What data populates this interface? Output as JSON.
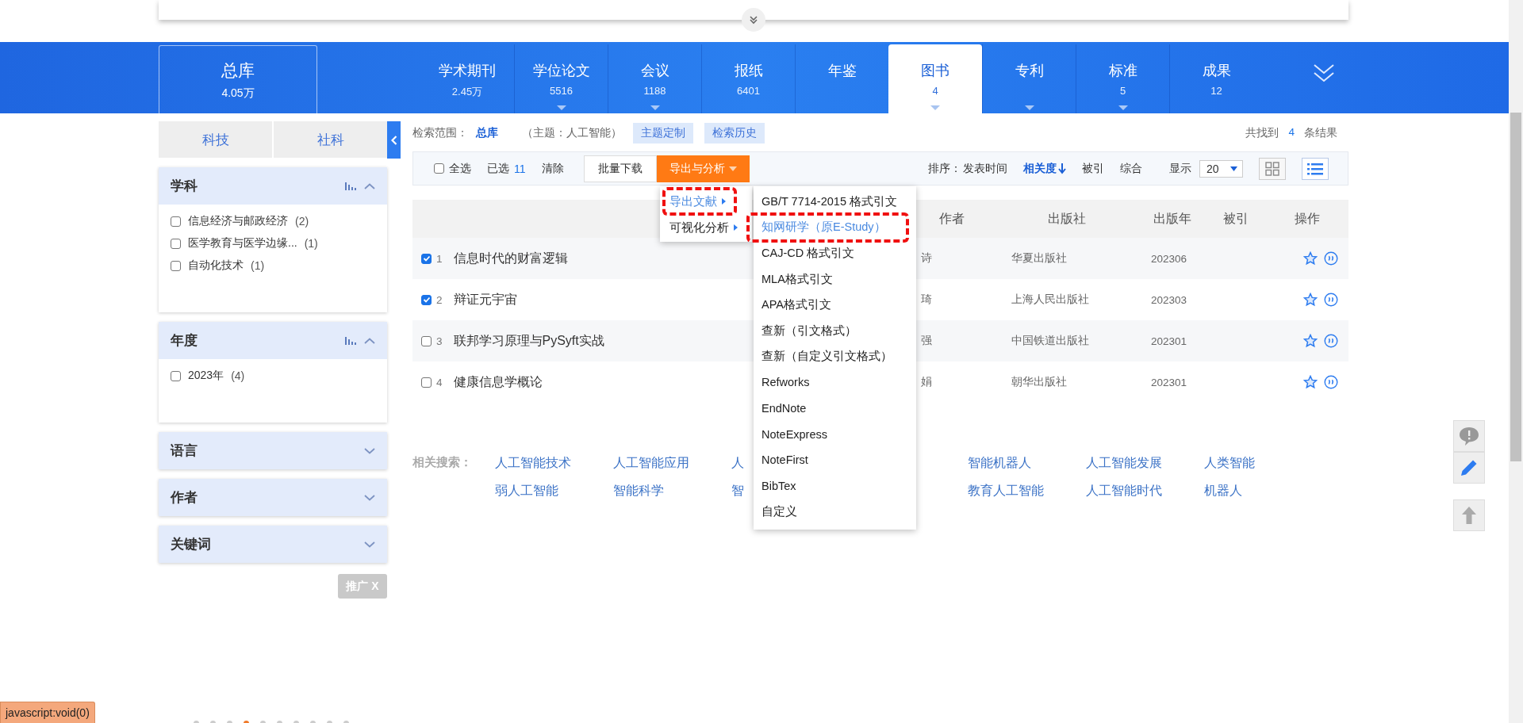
{
  "database_nav": {
    "total": {
      "label": "总库",
      "count": "4.05万"
    },
    "tabs": [
      {
        "label": "学术期刊",
        "count": "2.45万",
        "caret": false,
        "selected": false
      },
      {
        "label": "学位论文",
        "count": "5516",
        "caret": true,
        "selected": false
      },
      {
        "label": "会议",
        "count": "1188",
        "caret": true,
        "selected": false
      },
      {
        "label": "报纸",
        "count": "6401",
        "caret": false,
        "selected": false
      },
      {
        "label": "年鉴",
        "caret": false,
        "selected": false
      },
      {
        "label": "图书",
        "count": "4",
        "caret": true,
        "selected": true
      },
      {
        "label": "专利",
        "caret": true,
        "selected": false
      },
      {
        "label": "标准",
        "count": "5",
        "caret": true,
        "selected": false
      },
      {
        "label": "成果",
        "count": "12",
        "caret": false,
        "selected": false
      }
    ]
  },
  "sidebar": {
    "tabs": [
      {
        "label": "科技",
        "selected": false
      },
      {
        "label": "社科",
        "selected": false
      }
    ],
    "facets": [
      {
        "title": "学科",
        "expanded": true,
        "items": [
          {
            "label": "信息经济与邮政经济",
            "count": "(2)",
            "checked": false
          },
          {
            "label": "医学教育与医学边缘...",
            "count": "(1)",
            "checked": false
          },
          {
            "label": "自动化技术",
            "count": "(1)",
            "checked": false
          }
        ]
      },
      {
        "title": "年度",
        "expanded": true,
        "items": [
          {
            "label": "2023年",
            "count": "(4)",
            "checked": false
          }
        ]
      },
      {
        "title": "语言",
        "expanded": false
      },
      {
        "title": "作者",
        "expanded": false
      },
      {
        "title": "关键词",
        "expanded": false
      }
    ],
    "promo_button": "推广 X"
  },
  "search_info": {
    "scope_label": "检索范围：",
    "scope": "总库",
    "query": "（主题：人工智能）",
    "buttons": [
      "主题定制",
      "检索历史"
    ],
    "result_prefix": "共找到",
    "result_count": "4",
    "result_suffix": "条结果"
  },
  "toolbar": {
    "select_all": {
      "label": "全选",
      "checked": false
    },
    "selected_label": "已选",
    "selected_count": "11",
    "clear": "清除",
    "batch_download": "批量下载",
    "export_button": "导出与分析",
    "sort_label": "排序：",
    "sort_options": [
      {
        "label": "发表时间",
        "selected": false
      },
      {
        "label": "相关度",
        "selected": true
      },
      {
        "label": "被引",
        "selected": false
      },
      {
        "label": "综合",
        "selected": false
      }
    ],
    "display_label": "显示",
    "page_size": "20",
    "views": [
      {
        "kind": "grid",
        "selected": false
      },
      {
        "kind": "list",
        "selected": true
      }
    ]
  },
  "export_menu": {
    "items": [
      {
        "label": "导出文献",
        "highlighted": true
      },
      {
        "label": "可视化分析",
        "highlighted": false
      }
    ]
  },
  "format_menu": {
    "items": [
      {
        "label": "GB/T 7714-2015 格式引文",
        "highlighted": false
      },
      {
        "label": "知网研学（原E-Study）",
        "highlighted": true
      },
      {
        "label": "CAJ-CD 格式引文",
        "highlighted": false
      },
      {
        "label": "MLA格式引文",
        "highlighted": false
      },
      {
        "label": "APA格式引文",
        "highlighted": false
      },
      {
        "label": "查新（引文格式）",
        "highlighted": false
      },
      {
        "label": "查新（自定义引文格式）",
        "highlighted": false
      },
      {
        "label": "Refworks",
        "highlighted": false
      },
      {
        "label": "EndNote",
        "highlighted": false
      },
      {
        "label": "NoteExpress",
        "highlighted": false
      },
      {
        "label": "NoteFirst",
        "highlighted": false
      },
      {
        "label": "BibTex",
        "highlighted": false
      },
      {
        "label": "自定义",
        "highlighted": false
      }
    ]
  },
  "table": {
    "columns": [
      "作者",
      "出版社",
      "出版年",
      "被引",
      "操作"
    ],
    "rows": [
      {
        "index": "1",
        "checked": true,
        "title": "信息时代的财富逻辑",
        "author": "诗",
        "publisher": "华夏出版社",
        "year": "202306"
      },
      {
        "index": "2",
        "checked": true,
        "title": "辩证元宇宙",
        "author": "琦",
        "publisher": "上海人民出版社",
        "year": "202303"
      },
      {
        "index": "3",
        "checked": false,
        "title": "联邦学习原理与PySyft实战",
        "author": "强",
        "publisher": "中国铁道出版社",
        "year": "202301"
      },
      {
        "index": "4",
        "checked": false,
        "title": "健康信息学概论",
        "author": "娟",
        "publisher": "朝华出版社",
        "year": "202301"
      }
    ]
  },
  "related_search": {
    "label": "相关搜索：",
    "rows": [
      [
        "人工智能技术",
        "人工智能应用",
        "人",
        "智能机器人",
        "人工智能发展",
        "人类智能"
      ],
      [
        "弱人工智能",
        "智能科学",
        "智",
        "教育人工智能",
        "人工智能时代",
        "机器人"
      ]
    ]
  },
  "status_bar": {
    "text": "javascript:void(0)"
  },
  "carousel": {
    "dots": [
      {
        "selected": false
      },
      {
        "selected": false
      },
      {
        "selected": false
      },
      {
        "selected": true
      },
      {
        "selected": false
      },
      {
        "selected": false
      },
      {
        "selected": false
      },
      {
        "selected": false
      },
      {
        "selected": false
      },
      {
        "selected": false
      }
    ]
  }
}
